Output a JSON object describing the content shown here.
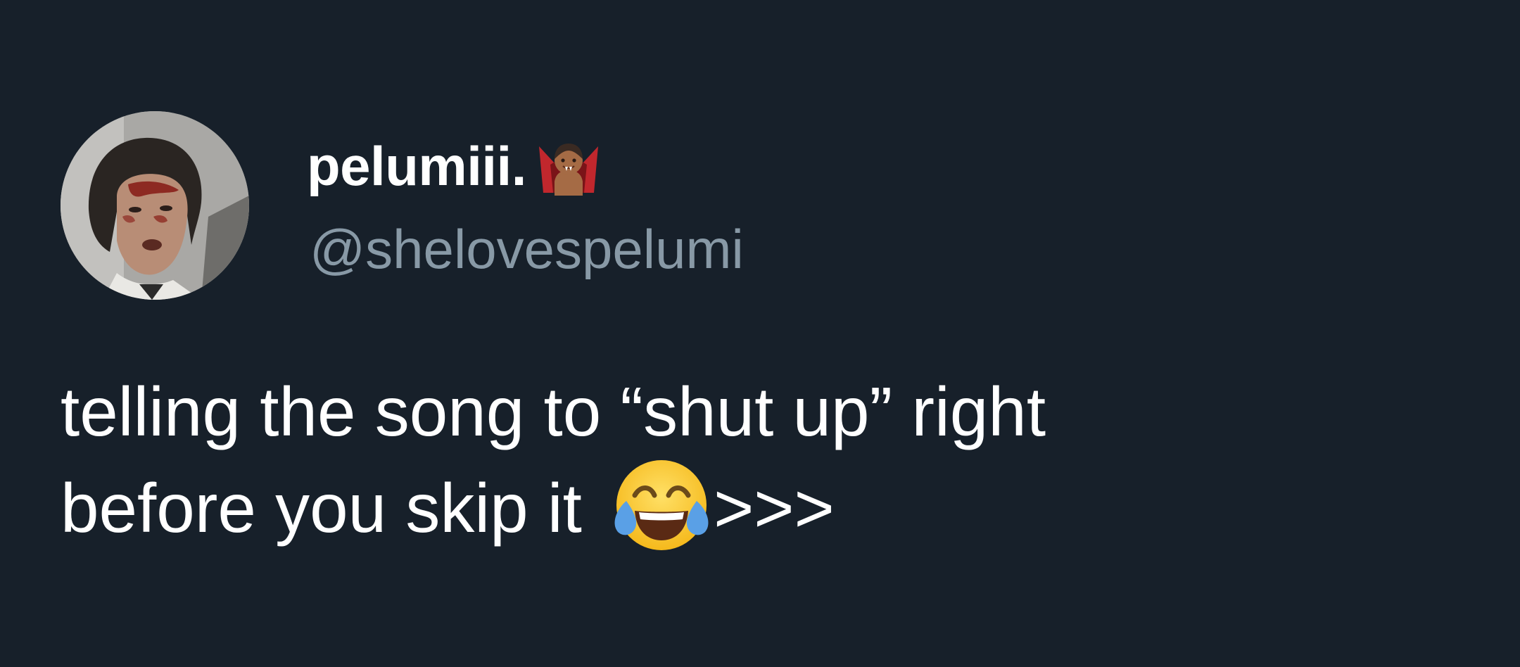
{
  "tweet": {
    "author": {
      "display_name": "pelumiii.",
      "name_emoji": "vampire-icon",
      "handle": "@shelovespelumi",
      "avatar": "avatar"
    },
    "text": {
      "line1": "telling the song to “shut up” right",
      "line2_before_emoji": "before you skip it ",
      "emoji": "face-with-tears-of-joy-icon",
      "line2_after_emoji": ">>>"
    }
  },
  "colors": {
    "background": "#17202a",
    "primary_text": "#ffffff",
    "secondary_text": "#8899a6"
  }
}
